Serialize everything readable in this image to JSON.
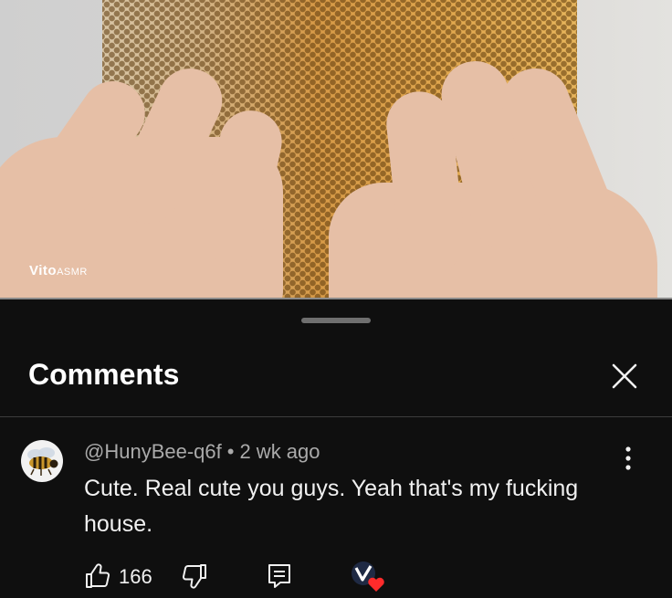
{
  "video": {
    "watermark_brand": "Vito",
    "watermark_suffix": "ASMR"
  },
  "comments_panel": {
    "title": "Comments",
    "close_icon": "close-icon",
    "comment": {
      "author": "@HunyBee-q6f",
      "separator": "•",
      "time": "2 wk ago",
      "text": "Cute. Real cute you guys. Yeah that's my fucking house.",
      "likes": "166",
      "icons": {
        "like": "thumbs-up-icon",
        "dislike": "thumbs-down-icon",
        "reply": "reply-icon",
        "more": "more-vertical-icon",
        "creator_heart": "creator-heart-icon"
      },
      "colors": {
        "heart": "#ff2b2b"
      }
    }
  }
}
